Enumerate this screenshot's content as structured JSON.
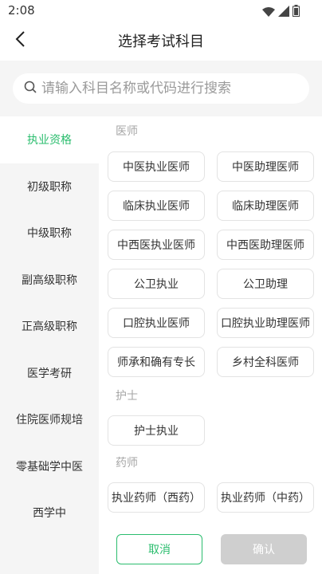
{
  "status_bar": {
    "time": "2:08",
    "icons": [
      "wifi-icon",
      "signal-icon",
      "battery-icon"
    ]
  },
  "header": {
    "title": "选择考试科目",
    "back_icon": "chevron-left-icon"
  },
  "search": {
    "placeholder": "请输入科目名称或代码进行搜索",
    "icon": "search-icon"
  },
  "sidebar": {
    "items": [
      {
        "label": "执业资格",
        "active": true
      },
      {
        "label": "初级职称"
      },
      {
        "label": "中级职称"
      },
      {
        "label": "副高级职称"
      },
      {
        "label": "正高级职称"
      },
      {
        "label": "医学考研"
      },
      {
        "label": "住院医师规培"
      },
      {
        "label": "零基础学中医"
      },
      {
        "label": "西学中"
      }
    ]
  },
  "sections": [
    {
      "title": "医师",
      "options": [
        "中医执业医师",
        "中医助理医师",
        "临床执业医师",
        "临床助理医师",
        "中西医执业医师",
        "中西医助理医师",
        "公卫执业",
        "公卫助理",
        "口腔执业医师",
        "口腔执业助理医师",
        "师承和确有专长",
        "乡村全科医师"
      ]
    },
    {
      "title": "护士",
      "options": [
        "护士执业"
      ]
    },
    {
      "title": "药师",
      "options": [
        "执业药师（西药）",
        "执业药师（中药）"
      ]
    }
  ],
  "footer": {
    "cancel_label": "取消",
    "confirm_label": "确认"
  },
  "colors": {
    "accent": "#2bbd6e",
    "sidebar_bg": "#f5f5f5",
    "disabled": "#cfcfcf"
  }
}
